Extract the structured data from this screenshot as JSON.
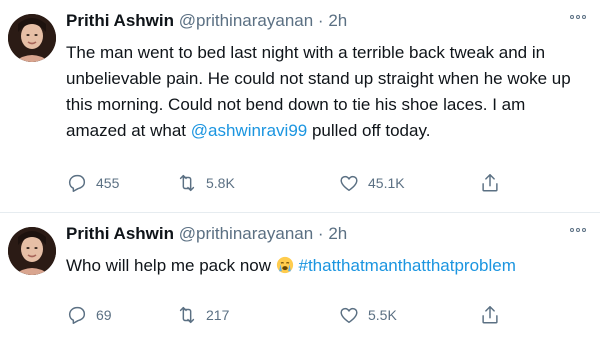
{
  "tweets": [
    {
      "author_name": "Prithi Ashwin",
      "handle": "@prithinarayanan",
      "separator": "·",
      "time": "2h",
      "text_before": "The man went to bed last night with a terrible back tweak and in unbelievable pain. He could not stand up straight when he woke up this morning. Could not bend down to tie his shoe laces. I am amazed at what ",
      "mention": "@ashwinravi99",
      "text_after": " pulled off today.",
      "replies": "455",
      "retweets": "5.8K",
      "likes": "45.1K"
    },
    {
      "author_name": "Prithi Ashwin",
      "handle": "@prithinarayanan",
      "separator": "·",
      "time": "2h",
      "text_before": "Who will help me pack now ",
      "hashtag": "#thatthatmanthatthatproblem",
      "replies": "69",
      "retweets": "217",
      "likes": "5.5K"
    }
  ],
  "colors": {
    "text": "#0f1419",
    "secondary": "#5b7083",
    "link": "#1b95e0"
  },
  "icons": [
    "more-icon",
    "reply-icon",
    "retweet-icon",
    "like-icon",
    "share-icon",
    "crying-face-emoji"
  ]
}
